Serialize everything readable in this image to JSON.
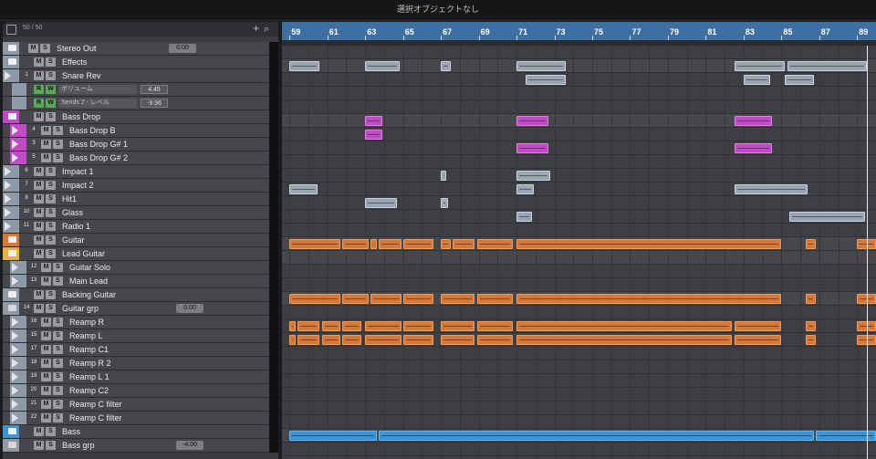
{
  "window": {
    "status_message": "選択オブジェクトなし"
  },
  "tracklist_header": {
    "count": "50 / 50",
    "add_symbol": "+",
    "search_symbol": "⌕"
  },
  "tracks": [
    {
      "name": "Stereo Out",
      "value": "0.00",
      "color": "#8e9aa8",
      "kind": "output"
    },
    {
      "name": "Effects",
      "color": "#8e9aa8",
      "kind": "folder"
    },
    {
      "name": "Snare Rev",
      "num": "1",
      "color": "#8e9aa8",
      "kind": "track"
    },
    {
      "name": "ボリューム",
      "value": "4.45",
      "kind": "auto"
    },
    {
      "name": "Sends 2 - レベル",
      "value": "-9.96",
      "kind": "auto"
    },
    {
      "name": "Bass Drop",
      "color": "#c24ac8",
      "kind": "folder"
    },
    {
      "name": "Bass Drop B",
      "num": "4",
      "color": "#c24ac8",
      "kind": "sub"
    },
    {
      "name": "Bass Drop G# 1",
      "num": "3",
      "color": "#c24ac8",
      "kind": "sub"
    },
    {
      "name": "Bass Drop G# 2",
      "num": "5",
      "color": "#c24ac8",
      "kind": "sub"
    },
    {
      "name": "Impact 1",
      "num": "6",
      "color": "#8e9aa8",
      "kind": "track"
    },
    {
      "name": "Impact 2",
      "num": "7",
      "color": "#8e9aa8",
      "kind": "track"
    },
    {
      "name": "Hit1",
      "num": "8",
      "color": "#8e9aa8",
      "kind": "track"
    },
    {
      "name": "Glass",
      "num": "10",
      "color": "#8e9aa8",
      "kind": "track"
    },
    {
      "name": "Radio 1",
      "num": "11",
      "color": "#8e9aa8",
      "kind": "track"
    },
    {
      "name": "Guitar",
      "color": "#d87838",
      "kind": "folder"
    },
    {
      "name": "Lead Guitar",
      "color": "#e6b432",
      "kind": "folder"
    },
    {
      "name": "Guitar Solo",
      "num": "12",
      "color": "#8e9aa8",
      "kind": "sub"
    },
    {
      "name": "Main Lead",
      "num": "13",
      "color": "#8e9aa8",
      "kind": "sub"
    },
    {
      "name": "Backing Guitar",
      "color": "#8e9aa8",
      "kind": "folder"
    },
    {
      "name": "Guitar grp",
      "num": "14",
      "value": "0.00",
      "color": "#8e9aa8",
      "kind": "group"
    },
    {
      "name": "Reamp R",
      "num": "16",
      "color": "#8e9aa8",
      "kind": "sub"
    },
    {
      "name": "Reamp L",
      "num": "15",
      "color": "#8e9aa8",
      "kind": "sub"
    },
    {
      "name": "Reamp C1",
      "num": "17",
      "color": "#8e9aa8",
      "kind": "sub"
    },
    {
      "name": "Reamp R 2",
      "num": "18",
      "color": "#8e9aa8",
      "kind": "sub"
    },
    {
      "name": "Reamp L 1",
      "num": "19",
      "color": "#8e9aa8",
      "kind": "sub"
    },
    {
      "name": "Reamp C2",
      "num": "20",
      "color": "#8e9aa8",
      "kind": "sub"
    },
    {
      "name": "Reamp C filter",
      "num": "21",
      "color": "#8e9aa8",
      "kind": "sub"
    },
    {
      "name": "Reamp C filter",
      "num": "22",
      "color": "#8e9aa8",
      "kind": "sub"
    },
    {
      "name": "Bass",
      "color": "#3a95d8",
      "kind": "folder"
    },
    {
      "name": "Bass grp",
      "value": "-4.00",
      "color": "#8e9aa8",
      "kind": "group"
    }
  ],
  "button_labels": {
    "mute": "M",
    "solo": "S",
    "read": "R",
    "write": "W"
  },
  "ruler": {
    "bars": [
      "59",
      "61",
      "63",
      "65",
      "67",
      "69",
      "71",
      "73",
      "75",
      "77",
      "79",
      "81",
      "83",
      "85",
      "87",
      "89"
    ],
    "start_bar": 58.6,
    "end_bar": 90.0
  },
  "events": [
    {
      "lane": 1,
      "from": 59.0,
      "to": 60.6,
      "color": "grey"
    },
    {
      "lane": 1,
      "from": 63.0,
      "to": 64.8,
      "color": "grey"
    },
    {
      "lane": 1,
      "from": 67.0,
      "to": 67.5,
      "color": "grey"
    },
    {
      "lane": 1,
      "from": 71.0,
      "to": 73.6,
      "color": "grey"
    },
    {
      "lane": 1,
      "from": 82.5,
      "to": 85.2,
      "color": "grey"
    },
    {
      "lane": 1,
      "from": 85.3,
      "to": 89.5,
      "color": "grey"
    },
    {
      "lane": 2,
      "from": 71.5,
      "to": 73.6,
      "color": "grey"
    },
    {
      "lane": 2,
      "from": 83.0,
      "to": 84.4,
      "color": "grey"
    },
    {
      "lane": 2,
      "from": 85.2,
      "to": 86.7,
      "color": "grey"
    },
    {
      "lane": 5,
      "from": 63.0,
      "to": 63.9,
      "color": "pink"
    },
    {
      "lane": 5,
      "from": 71.0,
      "to": 72.7,
      "color": "pink"
    },
    {
      "lane": 5,
      "from": 82.5,
      "to": 84.5,
      "color": "pink"
    },
    {
      "lane": 6,
      "from": 63.0,
      "to": 63.9,
      "color": "pink"
    },
    {
      "lane": 7,
      "from": 71.0,
      "to": 72.7,
      "color": "pink"
    },
    {
      "lane": 7,
      "from": 82.5,
      "to": 84.5,
      "color": "pink"
    },
    {
      "lane": 9,
      "from": 67.0,
      "to": 67.3,
      "color": "grey"
    },
    {
      "lane": 9,
      "from": 71.0,
      "to": 72.8,
      "color": "grey"
    },
    {
      "lane": 10,
      "from": 59.0,
      "to": 60.5,
      "color": "grey"
    },
    {
      "lane": 10,
      "from": 71.0,
      "to": 71.9,
      "color": "grey"
    },
    {
      "lane": 10,
      "from": 82.5,
      "to": 86.4,
      "color": "grey"
    },
    {
      "lane": 11,
      "from": 63.0,
      "to": 64.7,
      "color": "grey"
    },
    {
      "lane": 11,
      "from": 67.0,
      "to": 67.4,
      "color": "grey"
    },
    {
      "lane": 12,
      "from": 71.0,
      "to": 71.8,
      "color": "grey"
    },
    {
      "lane": 12,
      "from": 85.4,
      "to": 89.4,
      "color": "grey"
    },
    {
      "lane": 14,
      "from": 59.0,
      "to": 61.7,
      "color": "orange"
    },
    {
      "lane": 14,
      "from": 61.8,
      "to": 63.2,
      "color": "orange"
    },
    {
      "lane": 14,
      "from": 63.3,
      "to": 63.6,
      "color": "orange"
    },
    {
      "lane": 14,
      "from": 63.7,
      "to": 64.9,
      "color": "orange"
    },
    {
      "lane": 14,
      "from": 65.0,
      "to": 66.6,
      "color": "orange"
    },
    {
      "lane": 14,
      "from": 67.0,
      "to": 67.5,
      "color": "orange"
    },
    {
      "lane": 14,
      "from": 67.6,
      "to": 68.8,
      "color": "orange"
    },
    {
      "lane": 14,
      "from": 68.9,
      "to": 70.8,
      "color": "orange"
    },
    {
      "lane": 14,
      "from": 71.0,
      "to": 85.0,
      "color": "orange"
    },
    {
      "lane": 14,
      "from": 86.3,
      "to": 86.8,
      "color": "orange"
    },
    {
      "lane": 14,
      "from": 89.0,
      "to": 90.0,
      "color": "orange"
    },
    {
      "lane": 18,
      "from": 59.0,
      "to": 61.7,
      "color": "orange"
    },
    {
      "lane": 18,
      "from": 61.8,
      "to": 63.2,
      "color": "orange"
    },
    {
      "lane": 18,
      "from": 63.3,
      "to": 64.9,
      "color": "orange"
    },
    {
      "lane": 18,
      "from": 65.0,
      "to": 66.6,
      "color": "orange"
    },
    {
      "lane": 18,
      "from": 67.0,
      "to": 68.8,
      "color": "orange"
    },
    {
      "lane": 18,
      "from": 68.9,
      "to": 70.8,
      "color": "orange"
    },
    {
      "lane": 18,
      "from": 71.0,
      "to": 85.0,
      "color": "orange"
    },
    {
      "lane": 18,
      "from": 86.3,
      "to": 86.8,
      "color": "orange"
    },
    {
      "lane": 18,
      "from": 89.0,
      "to": 90.0,
      "color": "orange"
    },
    {
      "lane": 20,
      "from": 59.0,
      "to": 59.3,
      "color": "orange"
    },
    {
      "lane": 20,
      "from": 59.4,
      "to": 60.6,
      "color": "orange"
    },
    {
      "lane": 20,
      "from": 60.7,
      "to": 61.7,
      "color": "orange"
    },
    {
      "lane": 20,
      "from": 61.8,
      "to": 62.8,
      "color": "orange"
    },
    {
      "lane": 20,
      "from": 63.0,
      "to": 64.9,
      "color": "orange"
    },
    {
      "lane": 20,
      "from": 65.0,
      "to": 66.6,
      "color": "orange"
    },
    {
      "lane": 20,
      "from": 67.0,
      "to": 68.8,
      "color": "orange"
    },
    {
      "lane": 20,
      "from": 68.9,
      "to": 70.8,
      "color": "orange"
    },
    {
      "lane": 20,
      "from": 71.0,
      "to": 82.4,
      "color": "orange"
    },
    {
      "lane": 20,
      "from": 82.5,
      "to": 85.0,
      "color": "orange"
    },
    {
      "lane": 20,
      "from": 86.3,
      "to": 86.8,
      "color": "orange"
    },
    {
      "lane": 20,
      "from": 89.0,
      "to": 90.0,
      "color": "orange"
    },
    {
      "lane": 21,
      "from": 59.0,
      "to": 59.3,
      "color": "orange"
    },
    {
      "lane": 21,
      "from": 59.4,
      "to": 60.6,
      "color": "orange"
    },
    {
      "lane": 21,
      "from": 60.7,
      "to": 61.7,
      "color": "orange"
    },
    {
      "lane": 21,
      "from": 61.8,
      "to": 62.8,
      "color": "orange"
    },
    {
      "lane": 21,
      "from": 63.0,
      "to": 64.9,
      "color": "orange"
    },
    {
      "lane": 21,
      "from": 65.0,
      "to": 66.6,
      "color": "orange"
    },
    {
      "lane": 21,
      "from": 67.0,
      "to": 68.8,
      "color": "orange"
    },
    {
      "lane": 21,
      "from": 68.9,
      "to": 70.8,
      "color": "orange"
    },
    {
      "lane": 21,
      "from": 71.0,
      "to": 82.4,
      "color": "orange"
    },
    {
      "lane": 21,
      "from": 82.5,
      "to": 85.0,
      "color": "orange"
    },
    {
      "lane": 21,
      "from": 86.3,
      "to": 86.8,
      "color": "orange"
    },
    {
      "lane": 21,
      "from": 89.0,
      "to": 90.0,
      "color": "orange"
    },
    {
      "lane": 28,
      "from": 59.0,
      "to": 63.6,
      "color": "blue"
    },
    {
      "lane": 28,
      "from": 63.7,
      "to": 86.7,
      "color": "blue"
    },
    {
      "lane": 28,
      "from": 86.8,
      "to": 90.0,
      "color": "blue"
    }
  ]
}
